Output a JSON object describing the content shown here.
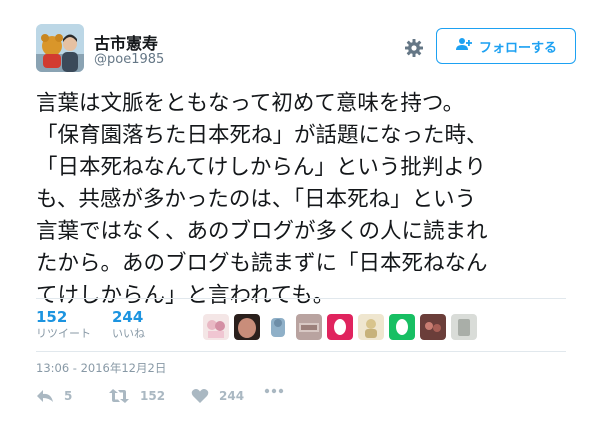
{
  "user": {
    "display_name": "古市憲寿",
    "handle": "@poe1985"
  },
  "follow_button": {
    "label": "フォローする"
  },
  "tweet": {
    "lines": [
      "言葉は文脈をともなって初めて意味を持つ。",
      "「保育園落ちた日本死ね」が話題になった時、",
      "「日本死ねなんてけしからん」という批判より",
      "も、共感が多かったのは、「日本死ね」という",
      "言葉ではなく、あのブログが多くの人に読まれ",
      "たから。あのブログも読まずに「日本死ねなん",
      "てけしからん」と言われても。"
    ]
  },
  "stats": {
    "retweets": {
      "count": "152",
      "label": "リツイート"
    },
    "likes": {
      "count": "244",
      "label": "いいね"
    }
  },
  "likers": [
    "avatar-1",
    "avatar-2",
    "avatar-3",
    "avatar-4",
    "avatar-5",
    "avatar-6",
    "avatar-7",
    "avatar-8",
    "avatar-9"
  ],
  "timestamp": "13:06 - 2016年12月2日",
  "actions": {
    "reply_count": "5",
    "retweet_count": "152",
    "like_count": "244"
  },
  "colors": {
    "accent": "#1da1f2",
    "stat_number": "#1c94e0",
    "muted": "#8899a6",
    "action_icon": "#aab8c2"
  },
  "icons": [
    "gear-icon",
    "add-user-icon",
    "reply-icon",
    "retweet-icon",
    "heart-icon",
    "more-icon"
  ]
}
